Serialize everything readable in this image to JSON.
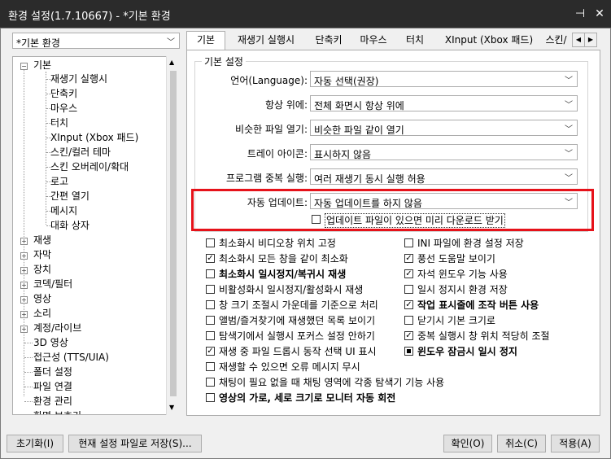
{
  "window": {
    "title": "환경 설정(1.7.10667) - *기본 환경"
  },
  "preset": {
    "value": "*기본 환경"
  },
  "tree": [
    "기본",
    "재생기 실행시",
    "단축키",
    "마우스",
    "터치",
    "XInput (Xbox 패드)",
    "스킨/컬러 테마",
    "스킨 오버레이/확대",
    "로고",
    "간편 열기",
    "메시지",
    "대화 상자",
    "재생",
    "자막",
    "장치",
    "코덱/필터",
    "영상",
    "소리",
    "계정/라이브",
    "3D 영상",
    "접근성 (TTS/UIA)",
    "폴더 설정",
    "파일 연결",
    "환경 관리",
    "화면 보호기"
  ],
  "tabs": [
    "기본",
    "재생기 실행시",
    "단축키",
    "마우스",
    "터치",
    "XInput (Xbox 패드)",
    "스킨/"
  ],
  "group": {
    "label": "기본 설정",
    "rows": [
      {
        "label": "언어(Language):",
        "value": "자동 선택(권장)"
      },
      {
        "label": "항상 위에:",
        "value": "전체 화면시 항상 위에"
      },
      {
        "label": "비슷한 파일 열기:",
        "value": "비슷한 파일 같이 열기"
      },
      {
        "label": "트레이 아이콘:",
        "value": "표시하지 않음"
      },
      {
        "label": "프로그램 중복 실행:",
        "value": "여러 재생기 동시 실행 허용"
      },
      {
        "label": "자동 업데이트:",
        "value": "자동 업데이트를 하지 않음"
      }
    ],
    "predownload": "업데이트 파일이 있으면 미리 다운로드 받기"
  },
  "options_left": [
    "최소화시 비디오창 위치 고정",
    "최소화시 모든 창을 같이 최소화",
    "최소화시 일시정지/복귀시 재생",
    "비활성화시 일시정지/활성화시 재생",
    "창 크기 조절시 가운데를 기준으로 처리",
    "앨범/즐겨찾기에 재생했던 목록 보이기",
    "탐색기에서 실행시 포커스 설정 안하기",
    "재생 중 파일 드롭시 동작 선택 UI 표시",
    "재생할 수 있으면 오류 메시지 무시",
    "채팅이 필요 없을 때 채팅 영역에 각종 탐색기 기능 사용",
    "영상의 가로, 세로 크기로 모니터 자동 회전"
  ],
  "options_right": [
    "INI 파일에 환경 설정 저장",
    "풍선 도움말 보이기",
    "자석 윈도우 기능 사용",
    "일시 정지시 환경 저장",
    "작업 표시줄에 조작 버튼 사용",
    "닫기시 기본 크기로",
    "중복 실행시 창 위치 적당히 조절",
    "윈도우 잠금시 일시 정지"
  ],
  "buttons": {
    "reset": "초기화(I)",
    "save_as": "현재 설정 파일로 저장(S)...",
    "ok": "확인(O)",
    "cancel": "취소(C)",
    "apply": "적용(A)"
  },
  "colors": {
    "highlight": "#e6121a",
    "titlebar": "#2b2b2b"
  }
}
